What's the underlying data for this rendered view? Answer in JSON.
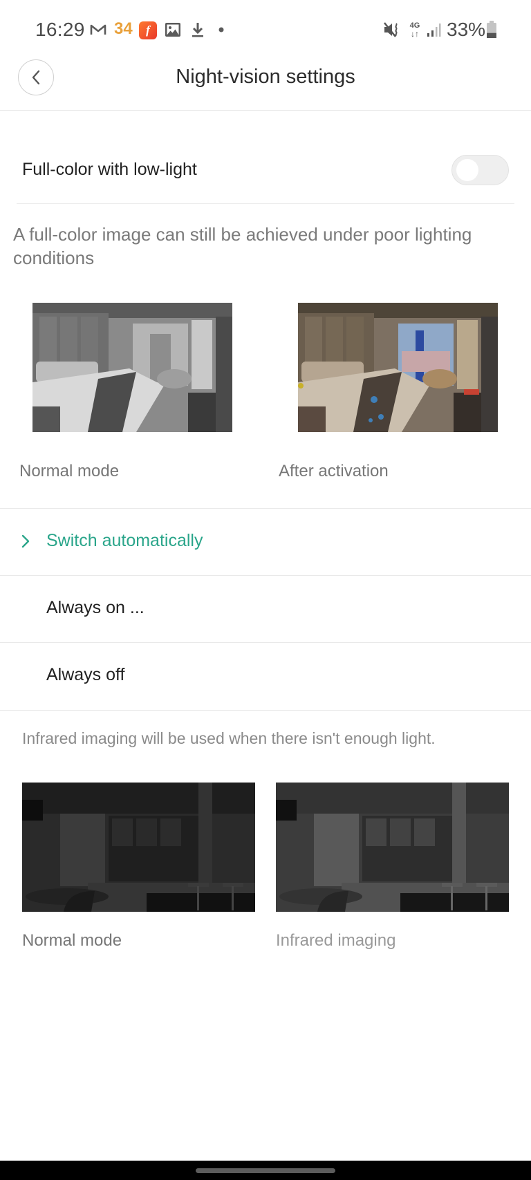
{
  "status_bar": {
    "time": "16:29",
    "notification_icons": [
      "gmail-icon",
      "badge-34",
      "app-f-icon",
      "image-icon",
      "download-icon",
      "dot-icon"
    ],
    "badge_count": "34",
    "app_letter": "f",
    "right_icons": [
      "mute-vibrate-icon",
      "4g-data-icon",
      "signal-icon",
      "battery-icon"
    ],
    "network_label": "4G",
    "battery_percent": "33%",
    "battery_level": 0.33
  },
  "header": {
    "title": "Night-vision settings",
    "back_icon": "chevron-left-icon"
  },
  "full_color": {
    "label": "Full-color with low-light",
    "enabled": false,
    "description": "A full-color image can still be achieved under poor lighting conditions",
    "images": [
      {
        "caption": "Normal mode",
        "style": "grayscale"
      },
      {
        "caption": "After activation",
        "style": "color"
      }
    ]
  },
  "mode_options": {
    "selected_index": 0,
    "items": [
      {
        "label": "Switch automatically",
        "selected": true,
        "icon": "chevron-right-icon"
      },
      {
        "label": "Always on ...",
        "selected": false
      },
      {
        "label": "Always off",
        "selected": false
      }
    ]
  },
  "infrared": {
    "description": "Infrared imaging will be used when there isn't enough light.",
    "images": [
      {
        "caption": "Normal mode",
        "style": "dark"
      },
      {
        "caption": "Infrared imaging",
        "style": "infrared"
      }
    ]
  },
  "colors": {
    "accent": "#2aa58a",
    "text_primary": "#222222",
    "text_secondary": "#7a7a7a",
    "divider": "#e9e9e9",
    "toggle_off": "#efefef"
  }
}
